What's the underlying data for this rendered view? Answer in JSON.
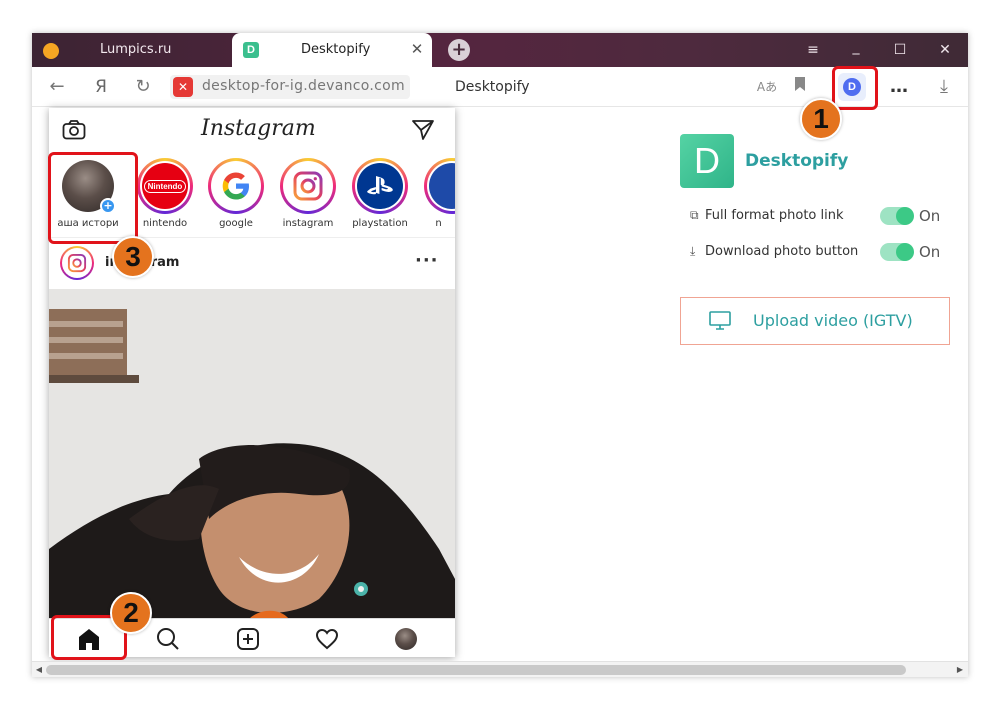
{
  "browser": {
    "tabs": [
      {
        "label": "Lumpics.ru",
        "active": false
      },
      {
        "label": "Desktopify",
        "active": true
      }
    ],
    "url": "desktop-for-ig.devanco.com",
    "page_title": "Desktopify",
    "extension_icon_letter": "D",
    "new_tab_symbol": "+",
    "close_tab_symbol": "✕",
    "window_controls": [
      "≡",
      "_",
      "☐",
      "✕"
    ]
  },
  "instagram": {
    "logo_text": "Instagram",
    "stories": [
      {
        "name": "аша истори"
      },
      {
        "name": "nintendo"
      },
      {
        "name": "google"
      },
      {
        "name": "instagram"
      },
      {
        "name": "playstation"
      },
      {
        "name": "n"
      }
    ],
    "nintendo_logo_text": "Nintendo",
    "post_user": "instagram",
    "post_more": "···"
  },
  "extension": {
    "logo_letter": "D",
    "name": "Desktopify",
    "settings": [
      {
        "label": "Full format photo link",
        "state": "On",
        "enabled": true
      },
      {
        "label": "Download photo button",
        "state": "On",
        "enabled": true
      }
    ],
    "upload_label": "Upload video (IGTV)"
  },
  "annotations": {
    "step1": "1",
    "step2": "2",
    "step3": "3",
    "highlight_color": "#e1131a",
    "badge_color": "#e4731e"
  },
  "colors": {
    "accent_teal": "#2d9fa0",
    "toggle_green": "#3cc986",
    "upload_border": "#f0a493"
  }
}
